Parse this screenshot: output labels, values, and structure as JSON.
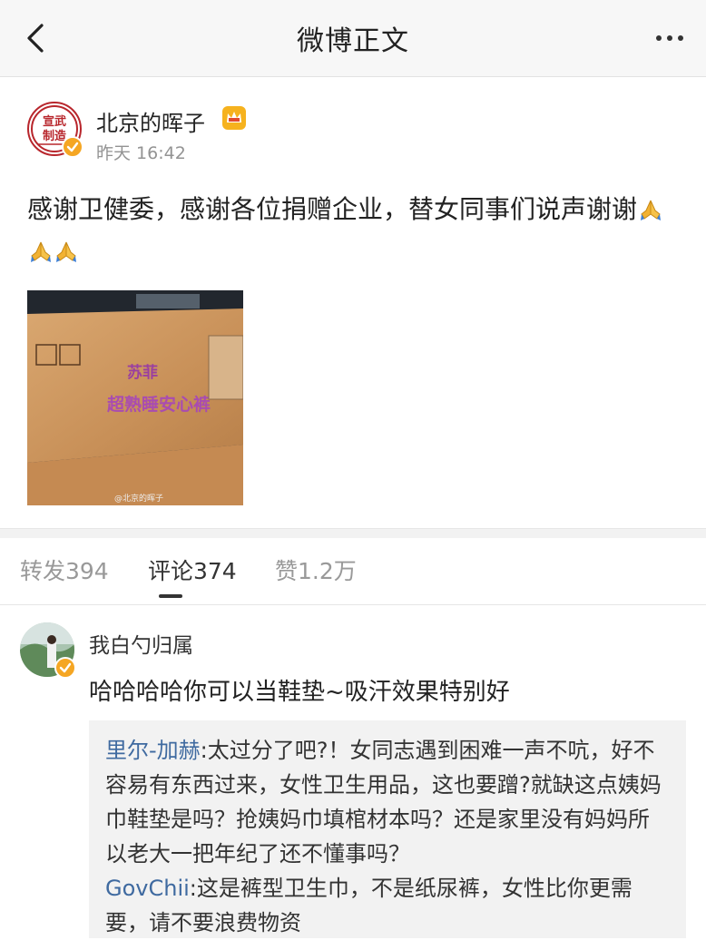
{
  "nav": {
    "title": "微博正文"
  },
  "post": {
    "author": "北京的晖子",
    "avatar_seal_text": [
      "宣武",
      "制造"
    ],
    "time": "昨天 16:42",
    "text": "感谢卫健委，感谢各位捐赠企业，替女同事们说声谢谢",
    "image_text": {
      "brand": "苏菲",
      "product": "超熟睡安心裤",
      "watermark": "@北京的晖子"
    }
  },
  "tabs": [
    {
      "label": "转发394"
    },
    {
      "label": "评论374"
    },
    {
      "label": "赞1.2万"
    }
  ],
  "comment": {
    "user": "我白勺归属",
    "text": "哈哈哈哈你可以当鞋垫~吸汗效果特别好",
    "replies": [
      {
        "user": "里尔-加赫",
        "text": ":太过分了吧?！女同志遇到困难一声不吭，好不容易有东西过来，女性卫生用品，这也要蹭?就缺这点姨妈巾鞋垫是吗？抢姨妈巾填棺材本吗？还是家里没有妈妈所以老大一把年纪了还不懂事吗？"
      },
      {
        "user": "GovChii",
        "text": ":这是裤型卫生巾，不是纸尿裤，女性比你更需要，请不要浪费物资"
      }
    ]
  },
  "colors": {
    "nav_bg": "#f7f7f7",
    "link": "#3f6aa0",
    "verified": "#f5a623",
    "seal_red": "#b8262c"
  }
}
